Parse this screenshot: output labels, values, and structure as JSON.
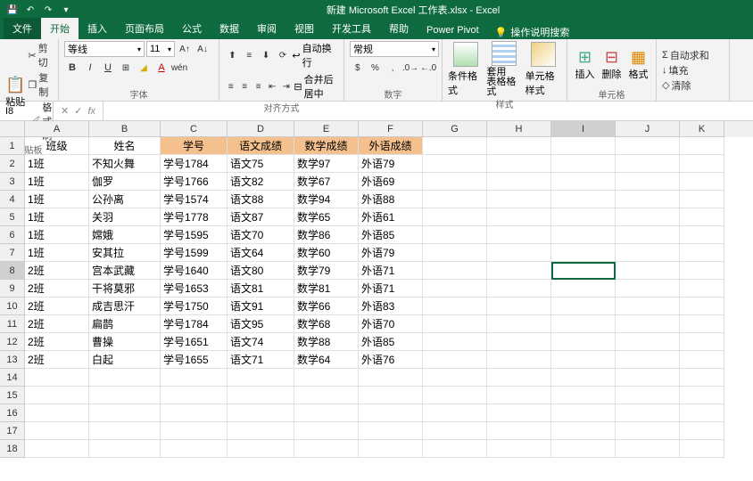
{
  "title": "新建 Microsoft Excel 工作表.xlsx - Excel",
  "tabs": {
    "file": "文件",
    "home": "开始",
    "insert": "插入",
    "layout": "页面布局",
    "formula": "公式",
    "data": "数据",
    "review": "审阅",
    "view": "视图",
    "dev": "开发工具",
    "help": "帮助",
    "pivot": "Power Pivot",
    "tellme": "操作说明搜索"
  },
  "groups": {
    "clipboard": "剪贴板",
    "font": "字体",
    "align": "对齐方式",
    "number": "数字",
    "styles": "样式",
    "cells": "单元格"
  },
  "clipboard": {
    "paste": "粘贴",
    "cut": "剪切",
    "copy": "复制",
    "format": "格式刷"
  },
  "font": {
    "name": "等线",
    "size": "11"
  },
  "align": {
    "wrap": "自动换行",
    "merge": "合并后居中"
  },
  "number": {
    "format": "常规"
  },
  "styles": {
    "cond": "条件格式",
    "table": "套用\n表格格式",
    "cell": "单元格样式"
  },
  "cells": {
    "insert": "插入",
    "delete": "删除",
    "format": "格式"
  },
  "editing": {
    "sum": "自动求和",
    "fill": "填充",
    "clear": "清除"
  },
  "namebox": "I8",
  "columns": [
    "A",
    "B",
    "C",
    "D",
    "E",
    "F",
    "G",
    "H",
    "I",
    "J",
    "K"
  ],
  "chart_data": {
    "type": "table",
    "headers": [
      "班级",
      "姓名",
      "学号",
      "语文成绩",
      "数学成绩",
      "外语成绩"
    ],
    "rows": [
      [
        "1班",
        "不知火舞",
        "学号1784",
        "语文75",
        "数学97",
        "外语79"
      ],
      [
        "1班",
        "伽罗",
        "学号1766",
        "语文82",
        "数学67",
        "外语69"
      ],
      [
        "1班",
        "公孙离",
        "学号1574",
        "语文88",
        "数学94",
        "外语88"
      ],
      [
        "1班",
        "关羽",
        "学号1778",
        "语文87",
        "数学65",
        "外语61"
      ],
      [
        "1班",
        "嫦娥",
        "学号1595",
        "语文70",
        "数学86",
        "外语85"
      ],
      [
        "1班",
        "安其拉",
        "学号1599",
        "语文64",
        "数学60",
        "外语79"
      ],
      [
        "2班",
        "宫本武藏",
        "学号1640",
        "语文80",
        "数学79",
        "外语71"
      ],
      [
        "2班",
        "干将莫邪",
        "学号1653",
        "语文81",
        "数学81",
        "外语71"
      ],
      [
        "2班",
        "成吉思汗",
        "学号1750",
        "语文91",
        "数学66",
        "外语83"
      ],
      [
        "2班",
        "扁鹊",
        "学号1784",
        "语文95",
        "数学68",
        "外语70"
      ],
      [
        "2班",
        "曹操",
        "学号1651",
        "语文74",
        "数学88",
        "外语85"
      ],
      [
        "2班",
        "白起",
        "学号1655",
        "语文71",
        "数学64",
        "外语76"
      ]
    ]
  }
}
